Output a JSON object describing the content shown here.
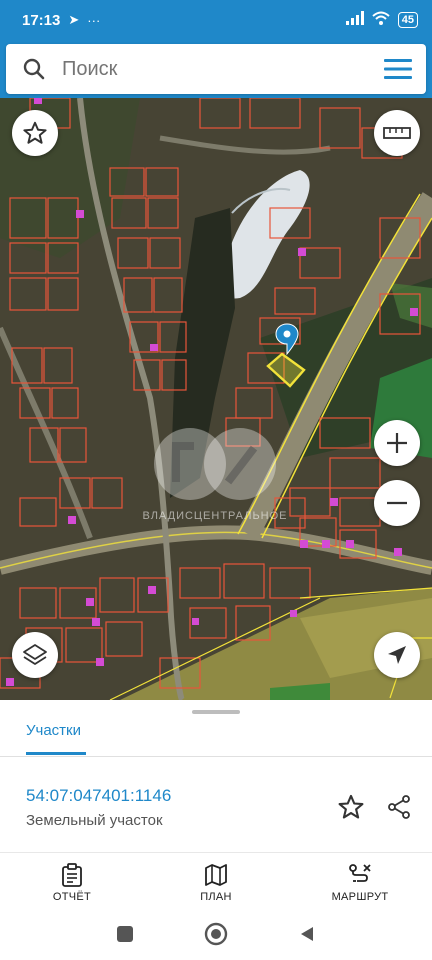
{
  "status_bar": {
    "time": "17:13",
    "battery": "45",
    "extra": "···"
  },
  "search": {
    "placeholder": "Поиск"
  },
  "map": {
    "watermark_text": "ВЛАДИСЦЕНТРАЛЬНОЕ"
  },
  "sheet": {
    "tab_label": "Участки",
    "parcel_id": "54:07:047401:1146",
    "parcel_type": "Земельный участок"
  },
  "bottom_nav": {
    "report": "ОТЧЁТ",
    "plan": "ПЛАН",
    "route": "МАРШРУТ"
  },
  "colors": {
    "accent": "#1f88c9",
    "parcel_outline": "#e8563a",
    "highlight": "#f2e23a"
  }
}
